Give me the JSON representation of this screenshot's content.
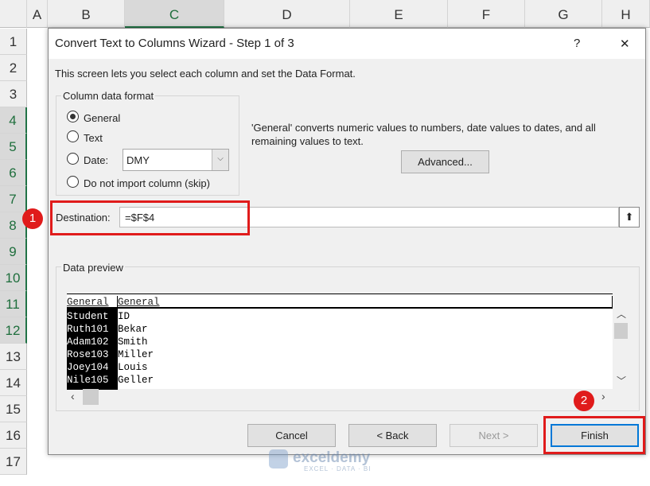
{
  "sheet": {
    "columns": [
      "A",
      "B",
      "C",
      "D",
      "E",
      "F",
      "G",
      "H"
    ],
    "rows": [
      "1",
      "2",
      "3",
      "4",
      "5",
      "6",
      "7",
      "8",
      "9",
      "10",
      "11",
      "12",
      "13",
      "14",
      "15",
      "16",
      "17"
    ]
  },
  "dialog": {
    "title": "Convert Text to Columns Wizard - Step 1 of 3",
    "help": "?",
    "close": "✕",
    "intro": "This screen lets you select each column and set the Data Format.",
    "group_label": "Column data format",
    "options": [
      {
        "label": "General",
        "key": "G",
        "selected": true
      },
      {
        "label": "Text",
        "key": "T",
        "selected": false
      },
      {
        "label": "Date:",
        "key": "D",
        "selected": false
      },
      {
        "label": "Do not import column (skip)",
        "key": "i",
        "selected": false
      }
    ],
    "date_format": "DMY",
    "description": "'General' converts numeric values to numbers, date values to dates, and all remaining values to text.",
    "advanced_label": "Advanced...",
    "destination_label": "Destination:",
    "destination_value": "=$F$4",
    "preview_label": "Data preview",
    "preview": {
      "headers": [
        "General",
        "General"
      ],
      "rows": [
        [
          "Student",
          "ID"
        ],
        [
          "Ruth101",
          "Bekar"
        ],
        [
          "Adam102",
          "Smith"
        ],
        [
          "Rose103",
          "Miller"
        ],
        [
          "Joey104",
          "Louis"
        ],
        [
          "Nile105",
          "Geller"
        ]
      ]
    },
    "buttons": {
      "cancel": "Cancel",
      "back": "< Back",
      "next": "Next >",
      "finish": "Finish"
    }
  },
  "callouts": [
    "1",
    "2"
  ],
  "watermark": {
    "name": "exceldemy",
    "tagline": "EXCEL · DATA · BI"
  }
}
